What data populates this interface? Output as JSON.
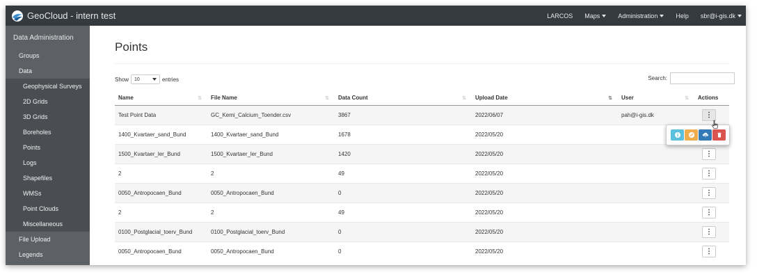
{
  "navbar": {
    "title": "GeoCloud - intern test",
    "items": [
      {
        "label": "LARCOS",
        "dropdown": false
      },
      {
        "label": "Maps",
        "dropdown": true
      },
      {
        "label": "Administration",
        "dropdown": true
      },
      {
        "label": "Help",
        "dropdown": false
      },
      {
        "label": "sbr@i-gis.dk",
        "dropdown": true
      }
    ]
  },
  "sidebar": {
    "header": "Data Administration",
    "items": [
      {
        "label": "Groups"
      },
      {
        "label": "Data"
      }
    ],
    "data_subitems": [
      {
        "label": "Geophysical Surveys"
      },
      {
        "label": "2D Grids"
      },
      {
        "label": "3D Grids"
      },
      {
        "label": "Boreholes"
      },
      {
        "label": "Points"
      },
      {
        "label": "Logs"
      },
      {
        "label": "Shapefiles"
      },
      {
        "label": "WMSs"
      },
      {
        "label": "Point Clouds"
      },
      {
        "label": "Miscellaneous"
      }
    ],
    "bottom_items": [
      {
        "label": "File Upload"
      },
      {
        "label": "Legends"
      }
    ]
  },
  "main": {
    "title": "Points",
    "show_label": "Show",
    "entries_value": "10",
    "entries_label": "entries",
    "search_label": "Search:",
    "search_value": "",
    "columns": [
      "Name",
      "File Name",
      "Data Count",
      "Upload Date",
      "User",
      "Actions"
    ],
    "rows": [
      {
        "name": "Test Point Data",
        "file": "GC_Kemi_Calcium_Toender.csv",
        "count": "3867",
        "date": "2022/06/07",
        "user": "pah@i-gis.dk"
      },
      {
        "name": "1400_Kvartaer_sand_Bund",
        "file": "1400_Kvartaer_sand_Bund",
        "count": "1678",
        "date": "2022/05/20",
        "user": ""
      },
      {
        "name": "1500_Kvartaer_ler_Bund",
        "file": "1500_Kvartaer_ler_Bund",
        "count": "1420",
        "date": "2022/05/20",
        "user": ""
      },
      {
        "name": "2",
        "file": "2",
        "count": "49",
        "date": "2022/05/20",
        "user": ""
      },
      {
        "name": "0050_Antropocaen_Bund",
        "file": "0050_Antropocaen_Bund",
        "count": "0",
        "date": "2022/05/20",
        "user": ""
      },
      {
        "name": "2",
        "file": "2",
        "count": "49",
        "date": "2022/05/20",
        "user": ""
      },
      {
        "name": "0100_Postglacial_toerv_Bund",
        "file": "0100_Postglacial_toerv_Bund",
        "count": "0",
        "date": "2022/05/20",
        "user": ""
      },
      {
        "name": "0050_Antropocaen_Bund",
        "file": "0050_Antropocaen_Bund",
        "count": "0",
        "date": "2022/05/20",
        "user": ""
      }
    ],
    "action_menu": [
      {
        "icon": "info-icon",
        "color": "#5bc0de"
      },
      {
        "icon": "edit-icon",
        "color": "#f0ad4e"
      },
      {
        "icon": "upload-icon",
        "color": "#337ab7"
      },
      {
        "icon": "trash-icon",
        "color": "#d9534f"
      }
    ]
  }
}
